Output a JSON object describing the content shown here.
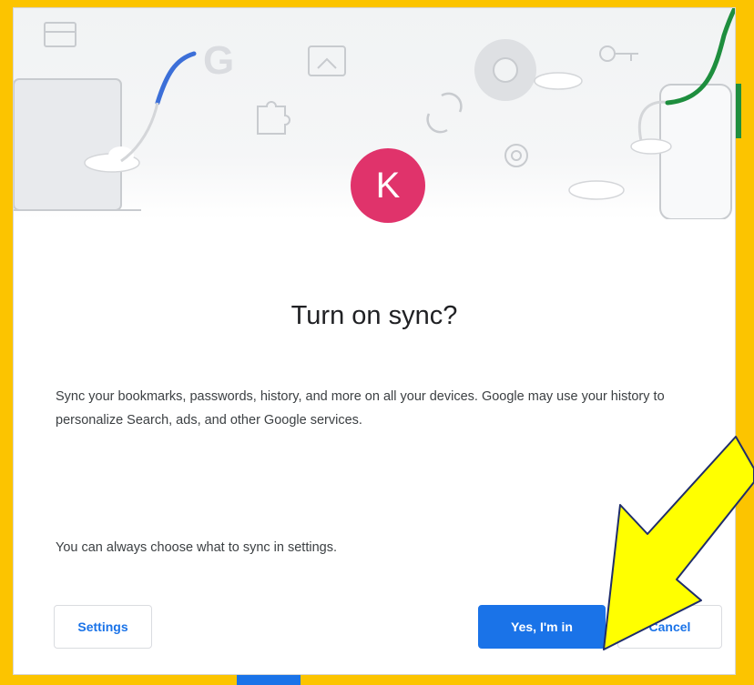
{
  "dialog": {
    "avatar_initial": "K",
    "title": "Turn on sync?",
    "description": "Sync your bookmarks, passwords, history, and more on all your devices. Google may use your history to personalize Search, ads, and other Google services.",
    "note": "You can always choose what to sync in settings."
  },
  "buttons": {
    "settings": "Settings",
    "confirm": "Yes, I'm in",
    "cancel": "Cancel"
  },
  "banner_icons": [
    "card-icon",
    "laptop-icon",
    "google-logo-icon",
    "cloud-icon",
    "image-icon",
    "puzzle-icon",
    "sync-icon",
    "chrome-icon",
    "gear-icon",
    "key-icon",
    "phone-icon"
  ],
  "colors": {
    "frame": "#fcc400",
    "avatar": "#e0336b",
    "primary": "#1a73e8",
    "arrow": "#ffff00",
    "green_line": "#1e8e3e",
    "blue_line": "#3c6fd8"
  }
}
